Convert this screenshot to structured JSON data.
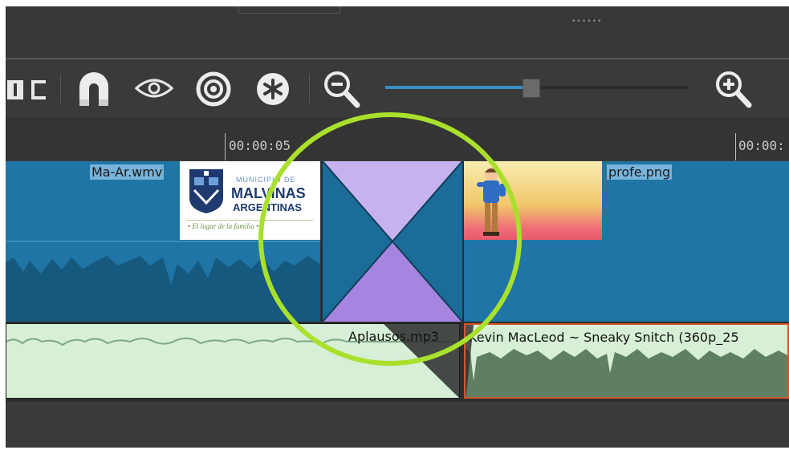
{
  "window": {
    "handle_glyph": "••••••"
  },
  "toolbar": {
    "icons": [
      "split-icon",
      "snap-magnet-icon",
      "scrub-eye-icon",
      "ripple-target-icon",
      "ripple-all-icon",
      "zoom-out-icon",
      "zoom-slider",
      "zoom-in-icon"
    ],
    "zoom_level": 0.48
  },
  "ruler": {
    "ticks": [
      "00:00:05",
      "00:00:"
    ]
  },
  "video_track": {
    "clips": [
      {
        "label": "Ma-Ar.wmv"
      },
      {
        "label": "profe.png"
      }
    ],
    "logo": {
      "line1": "MUNICIPIO DE",
      "line2": "MALVINAS",
      "line3": "ARGENTINAS",
      "motto": "• El lugar de la familia •"
    }
  },
  "audio_track": {
    "clips": [
      {
        "label": "Aplausos.mp3"
      },
      {
        "label": "Kevin MacLeod ~ Sneaky Snitch (360p_25"
      }
    ]
  },
  "colors": {
    "clip_blue": "#1f75a6",
    "audio_green": "#d6efd6",
    "transition_purple": "#b49ae6",
    "highlight_ring": "#a9e02b",
    "selected_border": "#d9542b"
  }
}
